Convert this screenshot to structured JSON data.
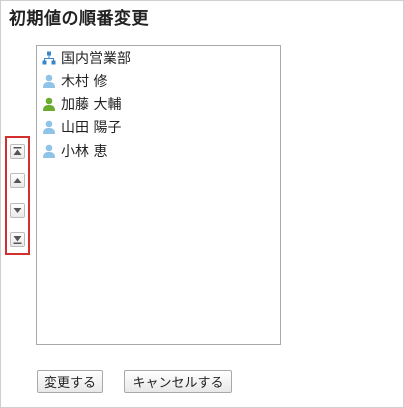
{
  "page": {
    "title": "初期値の順番変更"
  },
  "order_controls": [
    {
      "name": "move-to-top-button",
      "icon": "move-to-top-icon"
    },
    {
      "name": "move-up-button",
      "icon": "move-up-icon"
    },
    {
      "name": "move-down-button",
      "icon": "move-down-icon"
    },
    {
      "name": "move-to-bottom-button",
      "icon": "move-to-bottom-icon"
    }
  ],
  "list": {
    "items": [
      {
        "label": "国内営業部",
        "icon": "organization-icon"
      },
      {
        "label": "木村 修",
        "icon": "user-icon"
      },
      {
        "label": "加藤 大輔",
        "icon": "user-icon-green"
      },
      {
        "label": "山田 陽子",
        "icon": "user-icon"
      },
      {
        "label": "小林 恵",
        "icon": "user-icon"
      }
    ]
  },
  "buttons": {
    "save_label": "変更する",
    "cancel_label": "キャンセルする"
  },
  "colors": {
    "highlight": "#d32f2f",
    "user_blue": "#8fc3e8",
    "user_green": "#6bab2f",
    "org_blue": "#3a86c8"
  }
}
